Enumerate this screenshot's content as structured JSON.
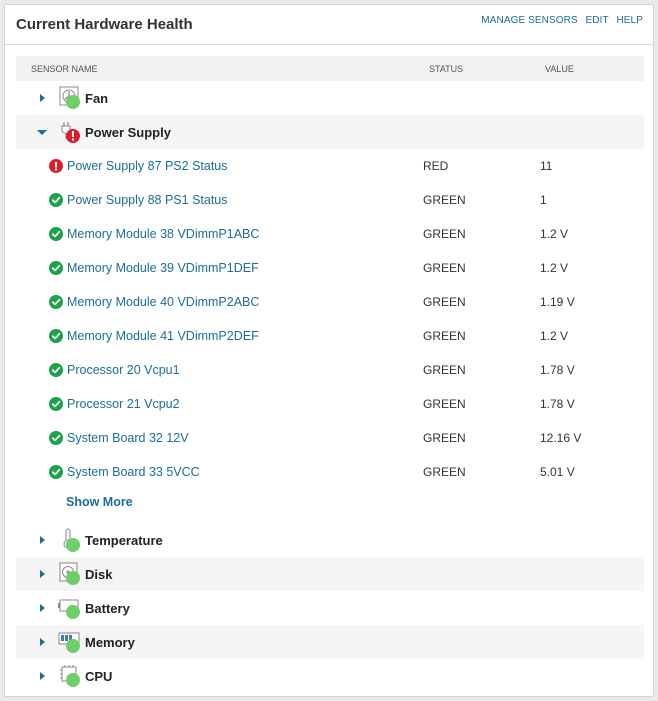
{
  "panel": {
    "title": "Current Hardware Health",
    "links": [
      "MANAGE SENSORS",
      "EDIT",
      "HELP"
    ]
  },
  "columns": {
    "name": "SENSOR NAME",
    "status": "STATUS",
    "value": "VALUE"
  },
  "groups": {
    "fan": {
      "label": "Fan",
      "icon": "fan-icon",
      "expanded": false,
      "status": "green"
    },
    "power_supply": {
      "label": "Power Supply",
      "icon": "power-plug-icon",
      "expanded": true,
      "status": "red"
    },
    "temperature": {
      "label": "Temperature",
      "icon": "thermometer-icon",
      "expanded": false,
      "status": "green"
    },
    "disk": {
      "label": "Disk",
      "icon": "disk-icon",
      "expanded": false,
      "status": "green"
    },
    "battery": {
      "label": "Battery",
      "icon": "battery-icon",
      "expanded": false,
      "status": "green"
    },
    "memory": {
      "label": "Memory",
      "icon": "memory-icon",
      "expanded": false,
      "status": "green"
    },
    "cpu": {
      "label": "CPU",
      "icon": "cpu-icon",
      "expanded": false,
      "status": "green"
    }
  },
  "sensors": [
    {
      "name": "Power Supply 87 PS2 Status",
      "status": "RED",
      "value": "11",
      "state": "error"
    },
    {
      "name": "Power Supply 88 PS1 Status",
      "status": "GREEN",
      "value": "1",
      "state": "ok"
    },
    {
      "name": "Memory Module 38 VDimmP1ABC",
      "status": "GREEN",
      "value": "1.2 V",
      "state": "ok"
    },
    {
      "name": "Memory Module 39 VDimmP1DEF",
      "status": "GREEN",
      "value": "1.2 V",
      "state": "ok"
    },
    {
      "name": "Memory Module 40 VDimmP2ABC",
      "status": "GREEN",
      "value": "1.19 V",
      "state": "ok"
    },
    {
      "name": "Memory Module 41 VDimmP2DEF",
      "status": "GREEN",
      "value": "1.2 V",
      "state": "ok"
    },
    {
      "name": "Processor 20 Vcpu1",
      "status": "GREEN",
      "value": "1.78 V",
      "state": "ok"
    },
    {
      "name": "Processor 21 Vcpu2",
      "status": "GREEN",
      "value": "1.78 V",
      "state": "ok"
    },
    {
      "name": "System Board 32 12V",
      "status": "GREEN",
      "value": "12.16 V",
      "state": "ok"
    },
    {
      "name": "System Board 33 5VCC",
      "status": "GREEN",
      "value": "5.01 V",
      "state": "ok"
    }
  ],
  "show_more": "Show More",
  "colors": {
    "link": "#1a6e99",
    "ok": "#1aa34a",
    "error": "#d9202a",
    "group_ok_dot": "#6ccf6a",
    "caret": "#1a6e99"
  }
}
